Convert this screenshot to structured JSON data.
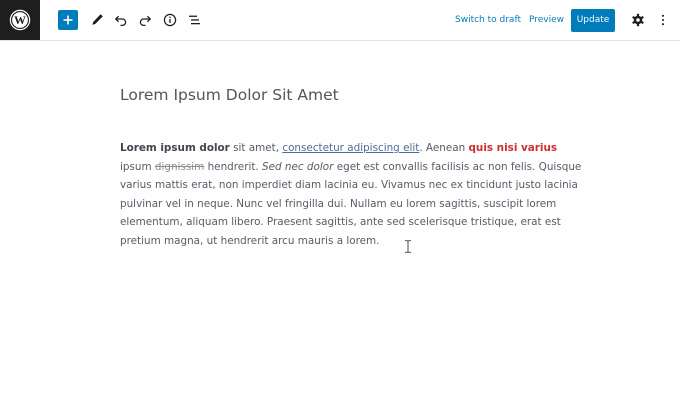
{
  "toolbar": {
    "logo_icon": "wordpress-logo-icon",
    "add_block_icon": "plus-icon",
    "tools_icon": "pencil-icon",
    "undo_icon": "undo-icon",
    "redo_icon": "redo-icon",
    "details_icon": "info-icon",
    "list_view_icon": "list-view-icon",
    "switch_to_draft_label": "Switch to draft",
    "preview_label": "Preview",
    "update_label": "Update",
    "settings_icon": "gear-icon",
    "options_icon": "more-vertical-icon"
  },
  "post": {
    "title": "Lorem Ipsum Dolor Sit Amet",
    "body": {
      "l1": {
        "bold": "Lorem ipsum dolor",
        "t1": " sit amet, ",
        "link": "consectetur adipiscing elit",
        "t2": ". Aenean ",
        "red_bold": "quis nisi varius"
      },
      "l2": {
        "t1": "ipsum ",
        "strike": "dignissim",
        "t2": " hendrerit. ",
        "italic": "Sed nec dolor",
        "t3": " eget est convallis facilisis ac non felis. Quisque"
      },
      "l3": "varius mattis erat, non imperdiet diam lacinia eu. Vivamus nec ex tincidunt justo lacinia",
      "l4": "pulvinar vel in neque. Nunc vel fringilla dui. Nullam eu lorem sagittis, suscipit lorem",
      "l5": "elementum, aliquam libero. Praesent sagittis, ante sed scelerisque tristique, erat est",
      "l6": "pretium magna, ut hendrerit arcu mauris a lorem."
    }
  },
  "colors": {
    "accent": "#007cba",
    "logo_bg": "#1e1e1e",
    "highlight_red": "#cf2e2e"
  },
  "cursor_icon": "text-cursor-icon"
}
